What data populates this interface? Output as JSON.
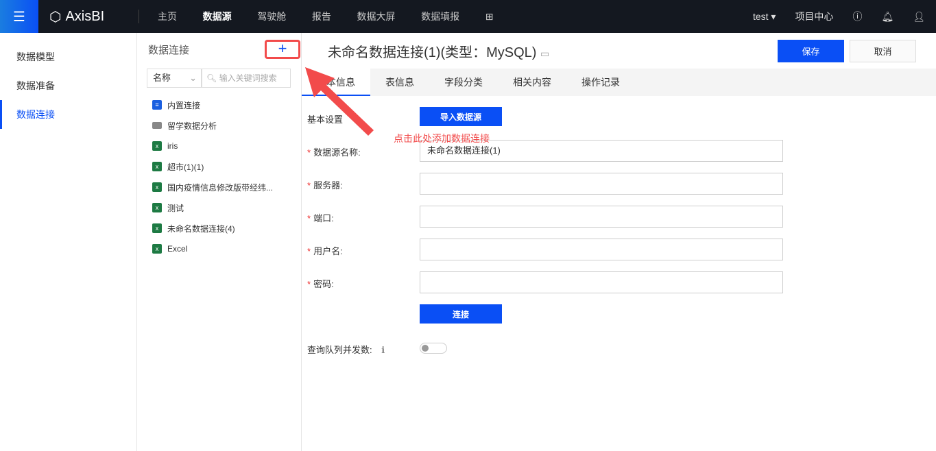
{
  "header": {
    "app_name": "AxisBI",
    "nav": [
      "主页",
      "数据源",
      "驾驶舱",
      "报告",
      "数据大屏",
      "数据填报"
    ],
    "active_nav": 1,
    "user": "test",
    "project_center": "项目中心"
  },
  "sidebar": {
    "items": [
      "数据模型",
      "数据准备",
      "数据连接"
    ],
    "active": 2
  },
  "list": {
    "title": "数据连接",
    "add": "+",
    "select_value": "名称",
    "search_placeholder": "输入关键词搜索",
    "items": [
      {
        "label": "内置连接",
        "icon": "database-icon"
      },
      {
        "label": "留学数据分析",
        "icon": "folder-icon"
      },
      {
        "label": "iris",
        "icon": "excel-icon"
      },
      {
        "label": "超市(1)(1)",
        "icon": "excel-icon"
      },
      {
        "label": "国内疫情信息修改版带经纬...",
        "icon": "excel-icon"
      },
      {
        "label": "测试",
        "icon": "excel-icon"
      },
      {
        "label": "未命名数据连接(4)",
        "icon": "excel-icon"
      },
      {
        "label": "Excel",
        "icon": "excel-icon"
      }
    ]
  },
  "main": {
    "title": "未命名数据连接(1)(类型：MySQL)",
    "save": "保存",
    "cancel": "取消",
    "tabs": [
      "基本信息",
      "表信息",
      "字段分类",
      "相关内容",
      "操作记录"
    ],
    "basic_settings": "基本设置",
    "import_btn": "导入数据源",
    "fields": [
      {
        "label": "数据源名称:",
        "value": "未命名数据连接(1)"
      },
      {
        "label": "服务器:",
        "value": ""
      },
      {
        "label": "端口:",
        "value": ""
      },
      {
        "label": "用户名:",
        "value": ""
      },
      {
        "label": "密码:",
        "value": ""
      }
    ],
    "connect_btn": "连接",
    "queue_label": "查询队列并发数:",
    "queue_enabled": false
  },
  "annotation": "点击此处添加数据连接",
  "colors": {
    "accent": "#0a4ff5",
    "annotation": "#f24b4b",
    "header_bg": "#141820"
  }
}
